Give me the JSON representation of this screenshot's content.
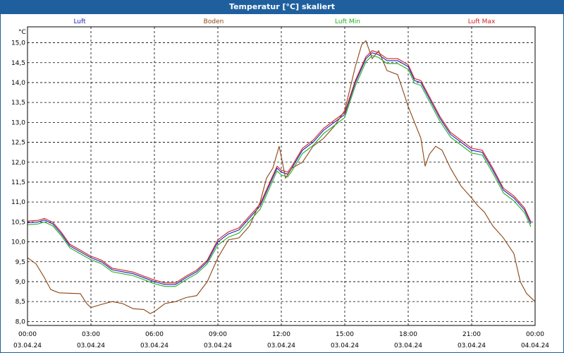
{
  "chart_data": {
    "type": "line",
    "title": "Temperatur [°C] skaliert",
    "ylabel": "°C",
    "ylim": [
      7.9,
      15.4
    ],
    "xlim_hours": [
      0,
      24
    ],
    "grid": true,
    "legend_position": "top",
    "y_ticks": [
      "8,0",
      "8,5",
      "9,0",
      "9,5",
      "10,0",
      "10,5",
      "11,0",
      "11,5",
      "12,0",
      "12,5",
      "13,0",
      "13,5",
      "14,0",
      "14,5",
      "15,0"
    ],
    "x_ticks": [
      {
        "time": "00:00",
        "date": "03.04.24"
      },
      {
        "time": "03:00",
        "date": "03.04.24"
      },
      {
        "time": "06:00",
        "date": "03.04.24"
      },
      {
        "time": "09:00",
        "date": "03.04.24"
      },
      {
        "time": "12:00",
        "date": "03.04.24"
      },
      {
        "time": "15:00",
        "date": "03.04.24"
      },
      {
        "time": "18:00",
        "date": "03.04.24"
      },
      {
        "time": "21:00",
        "date": "03.04.24"
      },
      {
        "time": "00:00",
        "date": "04.04.24"
      }
    ],
    "series": [
      {
        "name": "Luft",
        "color": "#2020c0",
        "points": [
          [
            0,
            10.48
          ],
          [
            0.5,
            10.5
          ],
          [
            0.8,
            10.55
          ],
          [
            1.2,
            10.45
          ],
          [
            1.6,
            10.2
          ],
          [
            2,
            9.9
          ],
          [
            2.5,
            9.75
          ],
          [
            3,
            9.6
          ],
          [
            3.5,
            9.5
          ],
          [
            4,
            9.3
          ],
          [
            4.5,
            9.25
          ],
          [
            5,
            9.2
          ],
          [
            5.5,
            9.1
          ],
          [
            6,
            9.0
          ],
          [
            6.5,
            8.93
          ],
          [
            7,
            8.93
          ],
          [
            7.5,
            9.1
          ],
          [
            8,
            9.25
          ],
          [
            8.5,
            9.5
          ],
          [
            9,
            10.0
          ],
          [
            9.5,
            10.2
          ],
          [
            10,
            10.3
          ],
          [
            10.5,
            10.6
          ],
          [
            11,
            10.9
          ],
          [
            11.5,
            11.5
          ],
          [
            11.8,
            11.85
          ],
          [
            12,
            11.75
          ],
          [
            12.3,
            11.7
          ],
          [
            12.5,
            11.85
          ],
          [
            13,
            12.3
          ],
          [
            13.5,
            12.5
          ],
          [
            14,
            12.8
          ],
          [
            14.5,
            13.0
          ],
          [
            15,
            13.2
          ],
          [
            15.5,
            14.0
          ],
          [
            16,
            14.6
          ],
          [
            16.3,
            14.75
          ],
          [
            16.6,
            14.7
          ],
          [
            17,
            14.55
          ],
          [
            17.5,
            14.55
          ],
          [
            18,
            14.4
          ],
          [
            18.3,
            14.05
          ],
          [
            18.6,
            14.0
          ],
          [
            19,
            13.6
          ],
          [
            19.5,
            13.1
          ],
          [
            20,
            12.7
          ],
          [
            20.5,
            12.5
          ],
          [
            21,
            12.3
          ],
          [
            21.5,
            12.25
          ],
          [
            22,
            11.8
          ],
          [
            22.5,
            11.3
          ],
          [
            23,
            11.1
          ],
          [
            23.5,
            10.8
          ],
          [
            23.8,
            10.45
          ]
        ]
      },
      {
        "name": "Boden",
        "color": "#8b4513",
        "points": [
          [
            0,
            9.6
          ],
          [
            0.4,
            9.45
          ],
          [
            0.8,
            9.1
          ],
          [
            1.1,
            8.8
          ],
          [
            1.5,
            8.72
          ],
          [
            2.5,
            8.7
          ],
          [
            2.8,
            8.45
          ],
          [
            3,
            8.35
          ],
          [
            3.5,
            8.43
          ],
          [
            4,
            8.5
          ],
          [
            4.5,
            8.45
          ],
          [
            5,
            8.32
          ],
          [
            5.5,
            8.3
          ],
          [
            5.8,
            8.2
          ],
          [
            6,
            8.25
          ],
          [
            6.5,
            8.45
          ],
          [
            7,
            8.5
          ],
          [
            7.5,
            8.6
          ],
          [
            8,
            8.65
          ],
          [
            8.5,
            9.0
          ],
          [
            9,
            9.6
          ],
          [
            9.5,
            10.05
          ],
          [
            10,
            10.1
          ],
          [
            10.5,
            10.4
          ],
          [
            11,
            11.0
          ],
          [
            11.3,
            11.6
          ],
          [
            11.6,
            11.85
          ],
          [
            11.9,
            12.4
          ],
          [
            12.2,
            11.6
          ],
          [
            12.5,
            11.85
          ],
          [
            13,
            12.0
          ],
          [
            13.5,
            12.4
          ],
          [
            14,
            12.6
          ],
          [
            14.5,
            12.9
          ],
          [
            15,
            13.3
          ],
          [
            15.5,
            14.4
          ],
          [
            15.8,
            14.95
          ],
          [
            16,
            15.05
          ],
          [
            16.3,
            14.6
          ],
          [
            16.6,
            14.8
          ],
          [
            17,
            14.3
          ],
          [
            17.5,
            14.2
          ],
          [
            18,
            13.4
          ],
          [
            18.3,
            13.0
          ],
          [
            18.6,
            12.6
          ],
          [
            18.8,
            11.9
          ],
          [
            19,
            12.2
          ],
          [
            19.3,
            12.4
          ],
          [
            19.6,
            12.3
          ],
          [
            20,
            11.85
          ],
          [
            20.5,
            11.4
          ],
          [
            21,
            11.1
          ],
          [
            21.3,
            10.9
          ],
          [
            21.6,
            10.75
          ],
          [
            22,
            10.4
          ],
          [
            22.5,
            10.1
          ],
          [
            23,
            9.7
          ],
          [
            23.3,
            9.0
          ],
          [
            23.6,
            8.7
          ],
          [
            24,
            8.5
          ]
        ]
      },
      {
        "name": "Luft Min",
        "color": "#20b020",
        "points": [
          [
            0,
            10.43
          ],
          [
            0.5,
            10.45
          ],
          [
            0.8,
            10.5
          ],
          [
            1.2,
            10.4
          ],
          [
            1.6,
            10.15
          ],
          [
            2,
            9.85
          ],
          [
            2.5,
            9.7
          ],
          [
            3,
            9.55
          ],
          [
            3.5,
            9.45
          ],
          [
            4,
            9.25
          ],
          [
            4.5,
            9.2
          ],
          [
            5,
            9.15
          ],
          [
            5.5,
            9.05
          ],
          [
            6,
            8.95
          ],
          [
            6.5,
            8.88
          ],
          [
            7,
            8.88
          ],
          [
            7.5,
            9.05
          ],
          [
            8,
            9.2
          ],
          [
            8.5,
            9.45
          ],
          [
            9,
            9.92
          ],
          [
            9.5,
            10.12
          ],
          [
            10,
            10.22
          ],
          [
            10.5,
            10.52
          ],
          [
            11,
            10.82
          ],
          [
            11.5,
            11.42
          ],
          [
            11.8,
            11.78
          ],
          [
            12,
            11.68
          ],
          [
            12.3,
            11.63
          ],
          [
            12.5,
            11.78
          ],
          [
            13,
            12.22
          ],
          [
            13.5,
            12.42
          ],
          [
            14,
            12.72
          ],
          [
            14.5,
            12.92
          ],
          [
            15,
            13.12
          ],
          [
            15.5,
            13.92
          ],
          [
            16,
            14.52
          ],
          [
            16.3,
            14.68
          ],
          [
            16.6,
            14.63
          ],
          [
            17,
            14.48
          ],
          [
            17.5,
            14.48
          ],
          [
            18,
            14.33
          ],
          [
            18.3,
            13.98
          ],
          [
            18.6,
            13.93
          ],
          [
            19,
            13.53
          ],
          [
            19.5,
            13.03
          ],
          [
            20,
            12.63
          ],
          [
            20.5,
            12.43
          ],
          [
            21,
            12.23
          ],
          [
            21.5,
            12.18
          ],
          [
            22,
            11.73
          ],
          [
            22.5,
            11.23
          ],
          [
            23,
            11.03
          ],
          [
            23.5,
            10.73
          ],
          [
            23.8,
            10.38
          ]
        ]
      },
      {
        "name": "Luft Max",
        "color": "#d02020",
        "points": [
          [
            0,
            10.52
          ],
          [
            0.5,
            10.54
          ],
          [
            0.8,
            10.59
          ],
          [
            1.2,
            10.49
          ],
          [
            1.6,
            10.24
          ],
          [
            2,
            9.94
          ],
          [
            2.5,
            9.79
          ],
          [
            3,
            9.64
          ],
          [
            3.5,
            9.54
          ],
          [
            4,
            9.34
          ],
          [
            4.5,
            9.29
          ],
          [
            5,
            9.24
          ],
          [
            5.5,
            9.14
          ],
          [
            6,
            9.04
          ],
          [
            6.5,
            8.97
          ],
          [
            7,
            8.97
          ],
          [
            7.5,
            9.14
          ],
          [
            8,
            9.29
          ],
          [
            8.5,
            9.54
          ],
          [
            9,
            10.05
          ],
          [
            9.5,
            10.25
          ],
          [
            10,
            10.35
          ],
          [
            10.5,
            10.65
          ],
          [
            11,
            10.95
          ],
          [
            11.5,
            11.55
          ],
          [
            11.8,
            11.9
          ],
          [
            12,
            11.8
          ],
          [
            12.3,
            11.75
          ],
          [
            12.5,
            11.9
          ],
          [
            13,
            12.35
          ],
          [
            13.5,
            12.55
          ],
          [
            14,
            12.85
          ],
          [
            14.5,
            13.05
          ],
          [
            15,
            13.25
          ],
          [
            15.5,
            14.05
          ],
          [
            16,
            14.65
          ],
          [
            16.3,
            14.8
          ],
          [
            16.6,
            14.75
          ],
          [
            17,
            14.6
          ],
          [
            17.5,
            14.6
          ],
          [
            18,
            14.45
          ],
          [
            18.3,
            14.1
          ],
          [
            18.6,
            14.05
          ],
          [
            19,
            13.65
          ],
          [
            19.5,
            13.15
          ],
          [
            20,
            12.75
          ],
          [
            20.5,
            12.55
          ],
          [
            21,
            12.35
          ],
          [
            21.5,
            12.3
          ],
          [
            22,
            11.85
          ],
          [
            22.5,
            11.35
          ],
          [
            23,
            11.15
          ],
          [
            23.5,
            10.85
          ],
          [
            23.8,
            10.5
          ]
        ]
      }
    ]
  }
}
